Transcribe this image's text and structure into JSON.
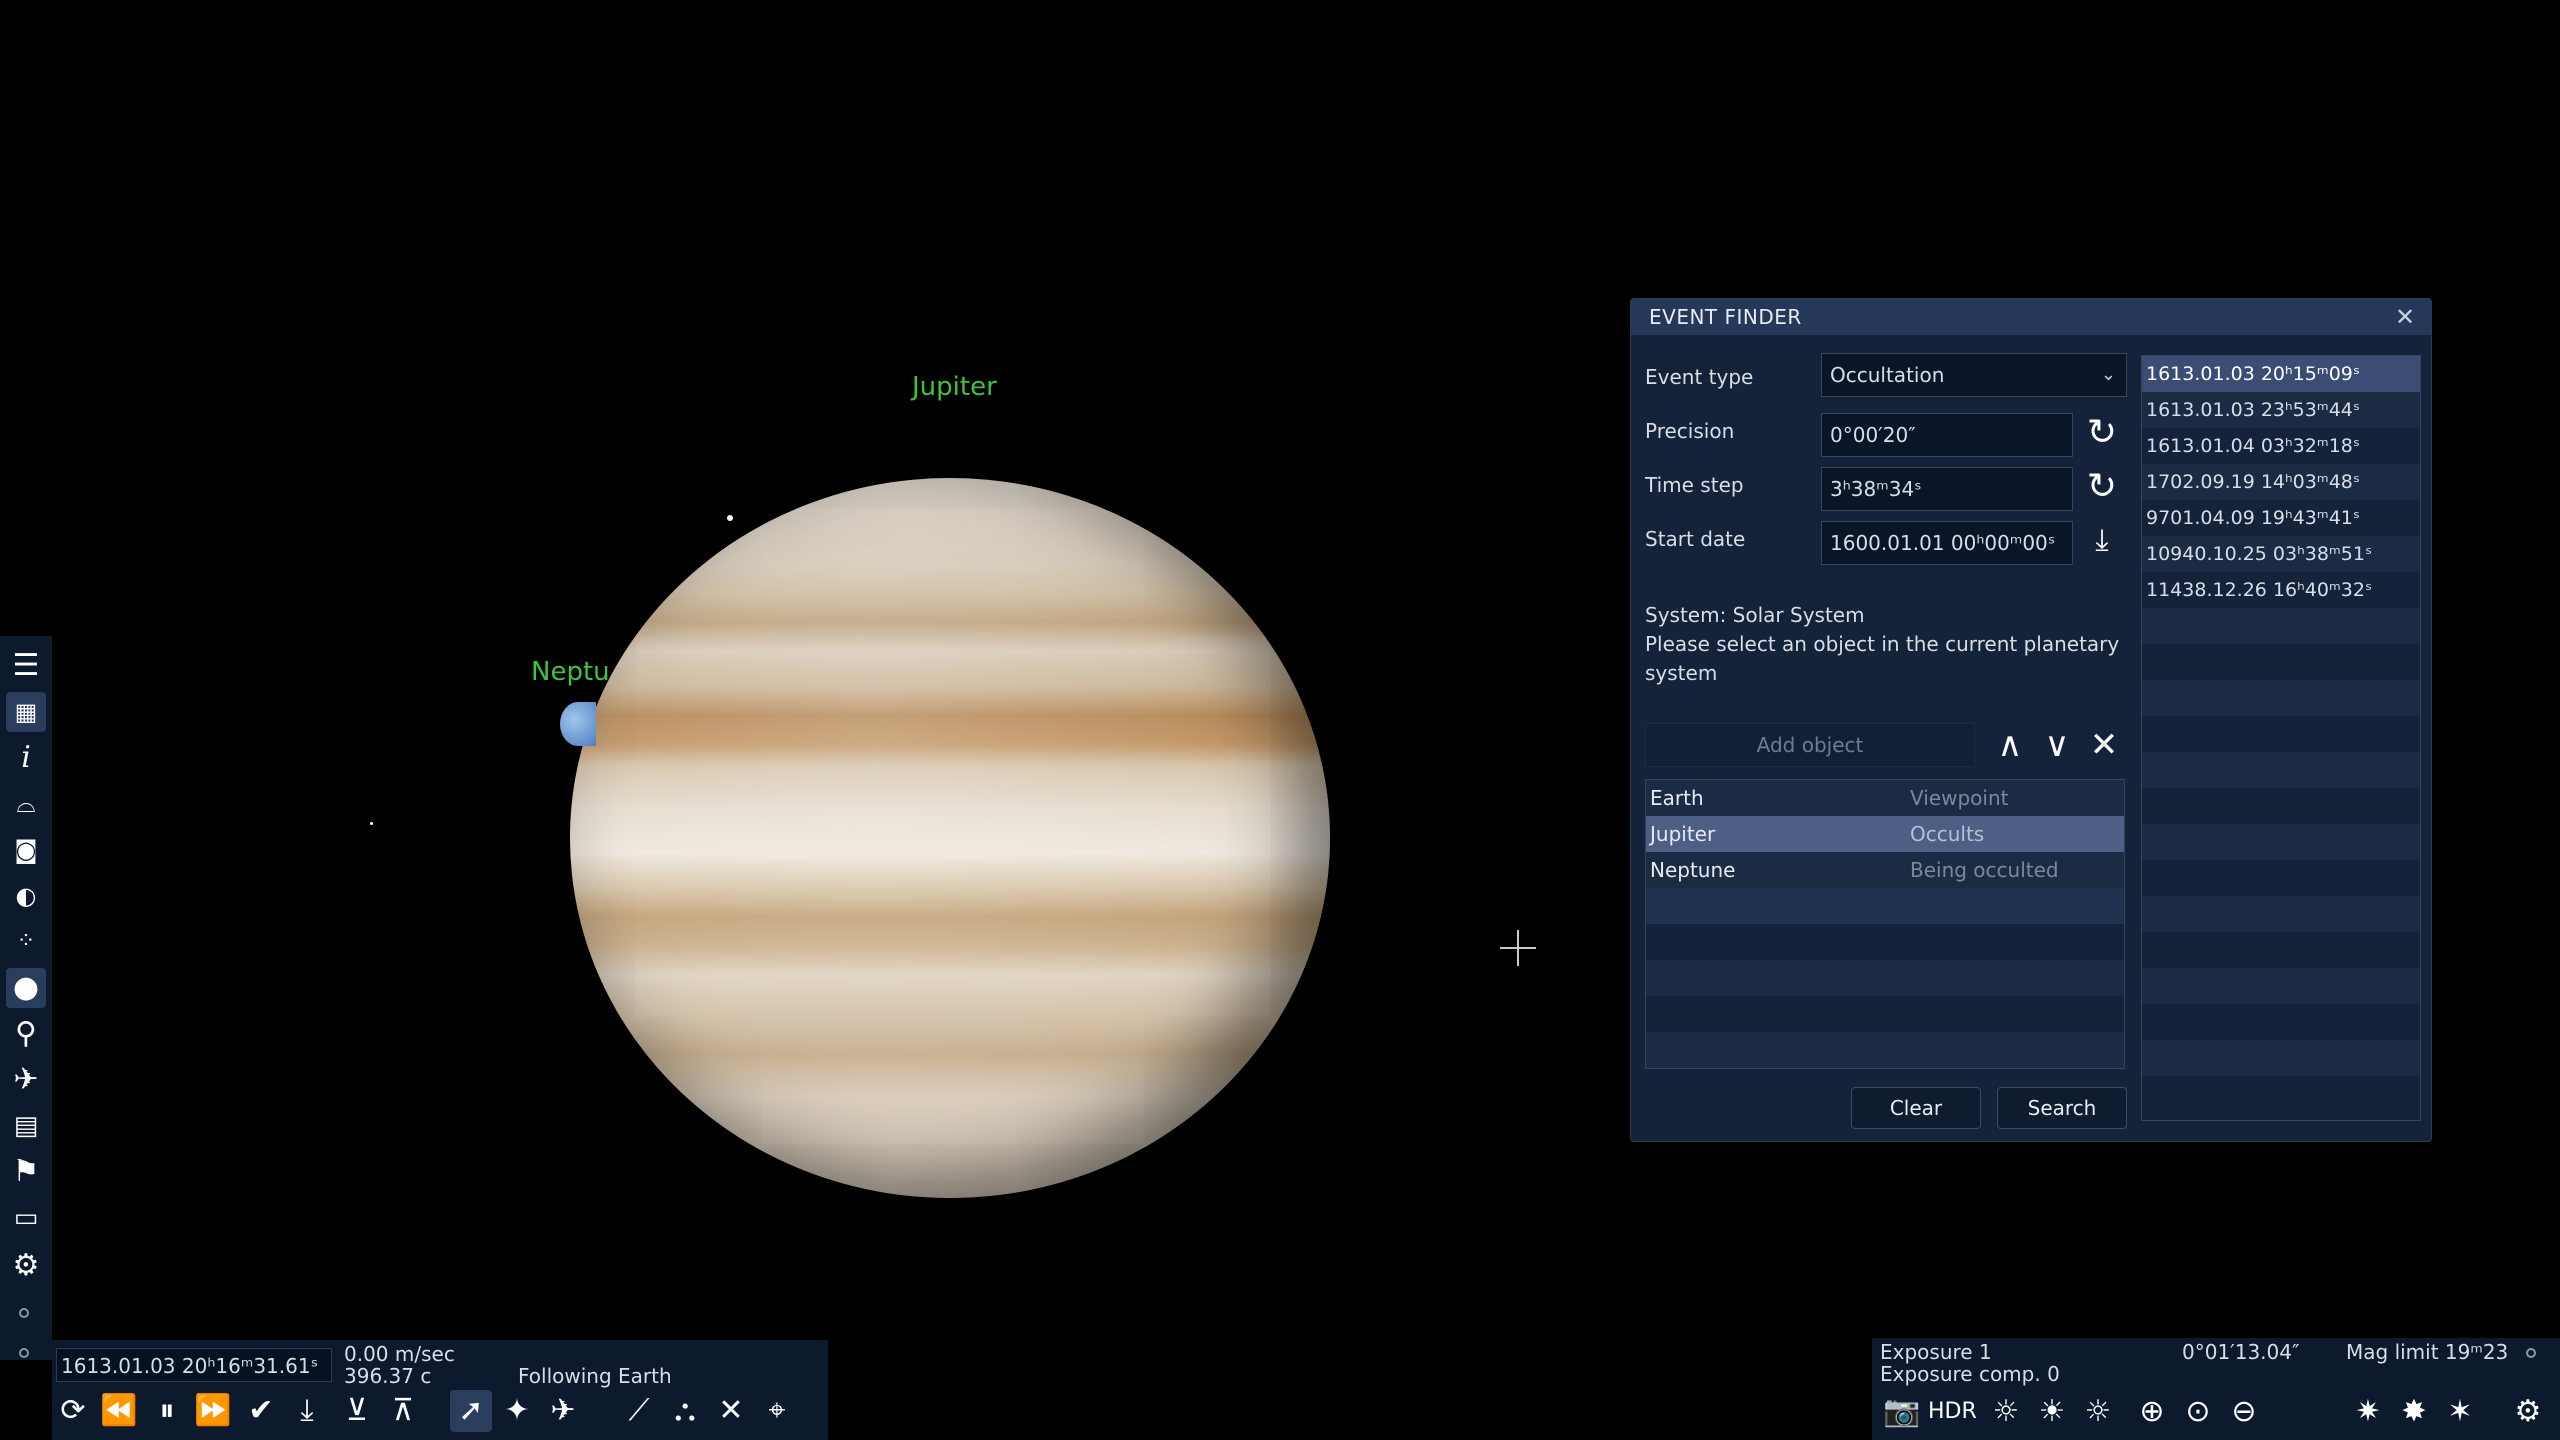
{
  "scene": {
    "labels": {
      "jupiter": "Jupiter",
      "neptune": "Neptu"
    }
  },
  "event_finder": {
    "title": "EVENT FINDER",
    "event_type_label": "Event type",
    "event_type_value": "Occultation",
    "precision_label": "Precision",
    "precision_value": "0°00′20″",
    "time_step_label": "Time step",
    "time_step_value": "3ʰ38ᵐ34ˢ",
    "start_date_label": "Start date",
    "start_date_value": "1600.01.01 00ʰ00ᵐ00ˢ",
    "info_line1": "System: Solar System",
    "info_line2": "Please select an object in the current planetary system",
    "add_object_placeholder": "Add object",
    "objects": [
      {
        "name": "Earth",
        "role": "Viewpoint"
      },
      {
        "name": "Jupiter",
        "role": "Occults"
      },
      {
        "name": "Neptune",
        "role": "Being occulted"
      }
    ],
    "clear_label": "Clear",
    "search_label": "Search",
    "results": [
      "1613.01.03 20ʰ15ᵐ09ˢ",
      "1613.01.03 23ʰ53ᵐ44ˢ",
      "1613.01.04 03ʰ32ᵐ18ˢ",
      "1702.09.19 14ʰ03ᵐ48ˢ",
      "9701.04.09 19ʰ43ᵐ41ˢ",
      "10940.10.25 03ʰ38ᵐ51ˢ",
      "11438.12.26 16ʰ40ᵐ32ˢ"
    ]
  },
  "time_panel": {
    "current_time": "1613.01.03 20ʰ16ᵐ31.61ˢ",
    "speed": "0.00 m/sec",
    "speed_c": "396.37 c",
    "following": "Following Earth"
  },
  "camera_panel": {
    "exposure": "Exposure 1",
    "exposure_comp": "Exposure comp. 0",
    "fov": "0°01′13.04″",
    "mag_limit": "Mag limit 19ᵐ23",
    "hdr": "HDR"
  },
  "colors": {
    "label_green": "#3fc23f",
    "panel_bg": "#15233a",
    "selection": "#4d5f85"
  }
}
